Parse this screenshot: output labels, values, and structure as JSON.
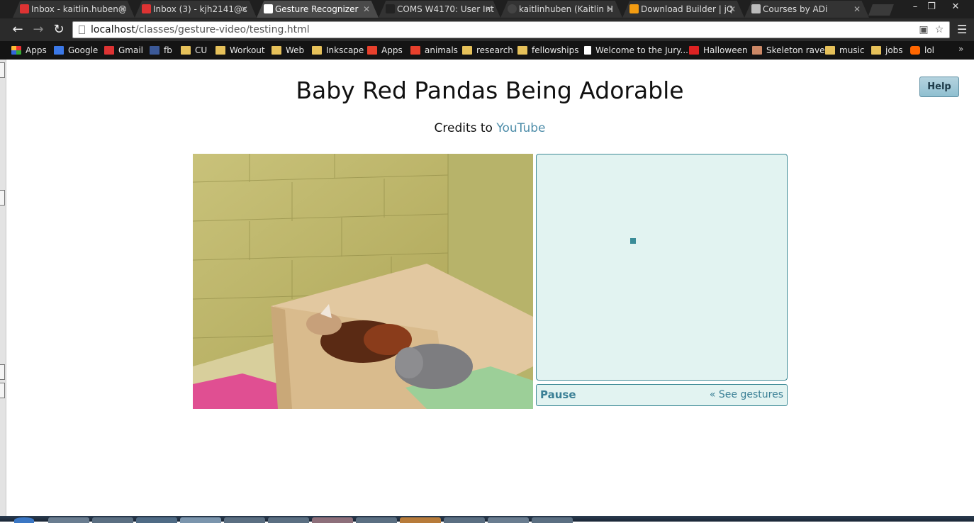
{
  "browser": {
    "tabs": [
      {
        "label": "Inbox - kaitlin.huben@",
        "icon": "gmail-icon",
        "icon_color": "#d33"
      },
      {
        "label": "Inbox (3) - kjh2141@c",
        "icon": "gmail-icon",
        "icon_color": "#d33"
      },
      {
        "label": "Gesture Recognizer",
        "icon": "page-icon",
        "icon_color": "#ffffff",
        "active": true
      },
      {
        "label": "COMS W4170: User Int",
        "icon": "courseworks-icon",
        "icon_color": "#222"
      },
      {
        "label": "kaitlinhuben (Kaitlin H",
        "icon": "github-icon",
        "icon_color": "#444"
      },
      {
        "label": "Download Builder | jQ",
        "icon": "jquery-ui-icon",
        "icon_color": "#f39c12"
      },
      {
        "label": "Courses by ADi",
        "icon": "courses-icon",
        "icon_color": "#bbb"
      }
    ],
    "url_host": "localhost",
    "url_path": "/classes/gesture-video/testing.html",
    "bookmarks": [
      {
        "label": "Apps",
        "icon": "apps"
      },
      {
        "label": "Google",
        "icon": "google"
      },
      {
        "label": "Gmail",
        "icon": "gmail"
      },
      {
        "label": "fb",
        "icon": "fb"
      },
      {
        "label": "CU",
        "icon": "folder"
      },
      {
        "label": "Workout",
        "icon": "folder"
      },
      {
        "label": "Web",
        "icon": "folder"
      },
      {
        "label": "Inkscape",
        "icon": "folder"
      },
      {
        "label": "Apps",
        "icon": "bf"
      },
      {
        "label": "animals",
        "icon": "bf"
      },
      {
        "label": "research",
        "icon": "folder"
      },
      {
        "label": "fellowships",
        "icon": "folder"
      },
      {
        "label": "Welcome to the Jury...",
        "icon": "page"
      },
      {
        "label": "Halloween",
        "icon": "yt"
      },
      {
        "label": "Skeleton rave",
        "icon": "skel"
      },
      {
        "label": "music",
        "icon": "folder"
      },
      {
        "label": "jobs",
        "icon": "folder"
      },
      {
        "label": "lol",
        "icon": "blog"
      }
    ],
    "bookmarks_more": "»"
  },
  "page": {
    "title": "Baby Red Pandas Being Adorable",
    "credits_prefix": "Credits to ",
    "credits_link": "YouTube",
    "help_label": "Help",
    "pause_label": "Pause",
    "see_gestures_label": "« See gestures"
  },
  "colors": {
    "accent": "#3a7f95",
    "canvas_bg": "#e2f3f1",
    "link": "#4f8eaa"
  }
}
